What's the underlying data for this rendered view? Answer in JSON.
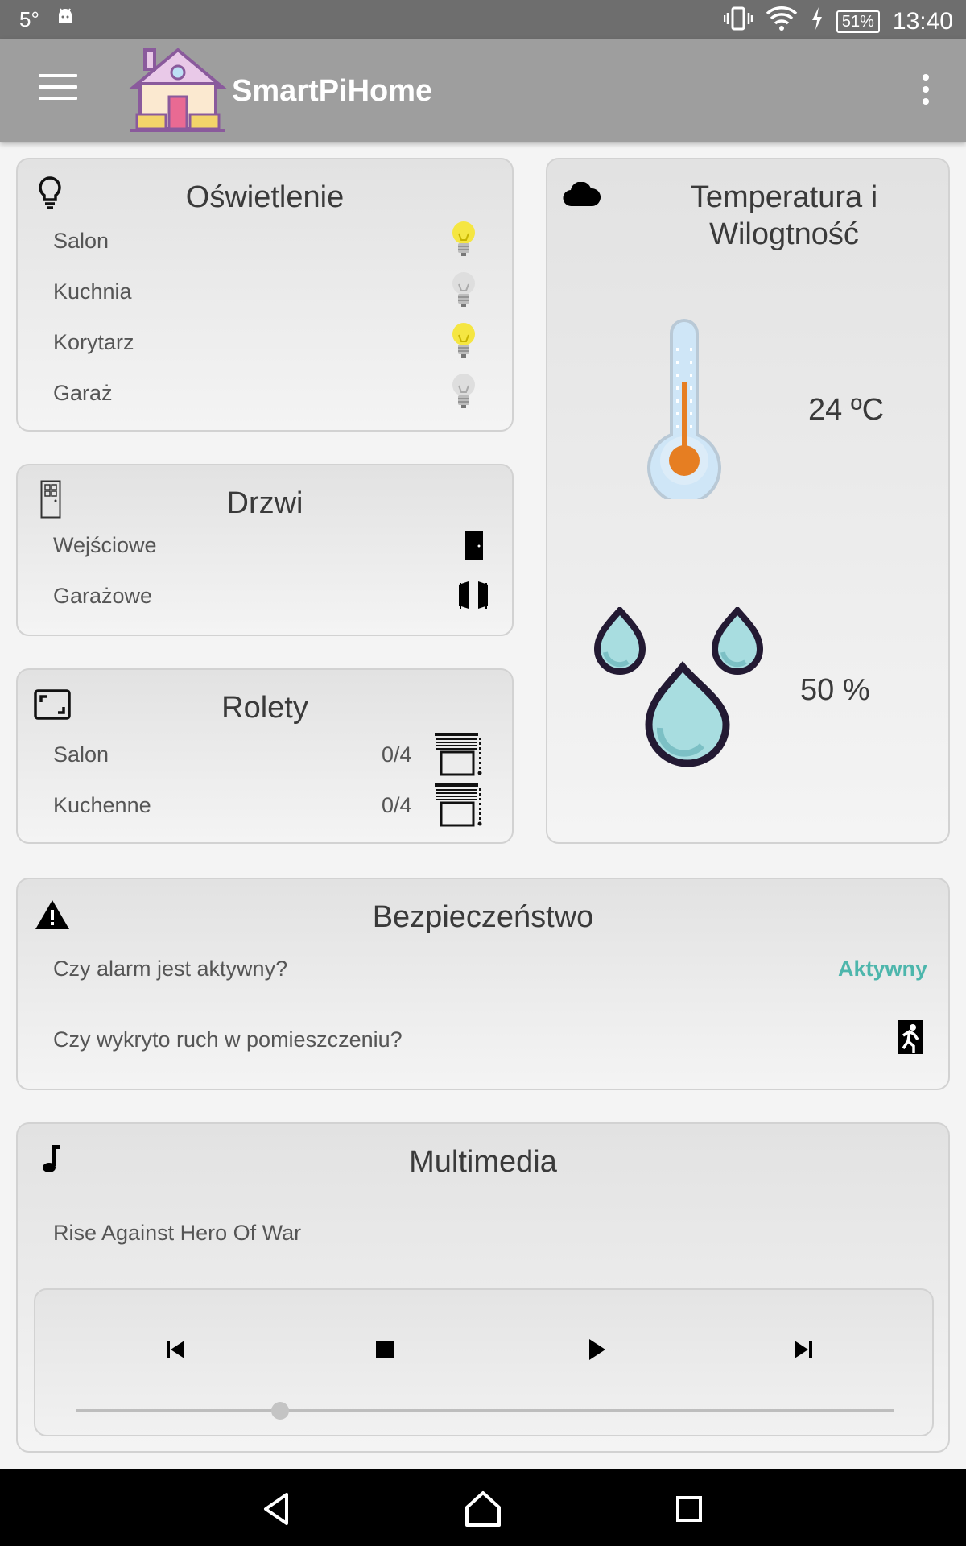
{
  "status_bar": {
    "temperature": "5°",
    "battery": "51%",
    "time": "13:40"
  },
  "app": {
    "title": "SmartPiHome"
  },
  "lighting": {
    "title": "Oświetlenie",
    "rooms": [
      {
        "label": "Salon",
        "state": "on"
      },
      {
        "label": "Kuchnia",
        "state": "off"
      },
      {
        "label": "Korytarz",
        "state": "on"
      },
      {
        "label": "Garaż",
        "state": "off"
      }
    ]
  },
  "doors": {
    "title": "Drzwi",
    "items": [
      {
        "label": "Wejściowe"
      },
      {
        "label": "Garażowe"
      }
    ]
  },
  "blinds": {
    "title": "Rolety",
    "items": [
      {
        "label": "Salon",
        "value": "0/4"
      },
      {
        "label": "Kuchenne",
        "value": "0/4"
      }
    ]
  },
  "climate": {
    "title": "Temperatura i Wilogtność",
    "temperature": "24 ºC",
    "humidity": "50 %"
  },
  "security": {
    "title": "Bezpieczeństwo",
    "alarm_question": "Czy alarm jest aktywny?",
    "alarm_status": "Aktywny",
    "motion_question": "Czy wykryto ruch w pomieszczeniu?"
  },
  "multimedia": {
    "title": "Multimedia",
    "track": "Rise Against Hero Of War",
    "progress": 0.25
  },
  "colors": {
    "accent": "#4db6ac",
    "bulb_on": "#f5e642",
    "bulb_off": "#d9d9d9",
    "thermometer": "#e67e22",
    "drop": "#a8dde0"
  }
}
